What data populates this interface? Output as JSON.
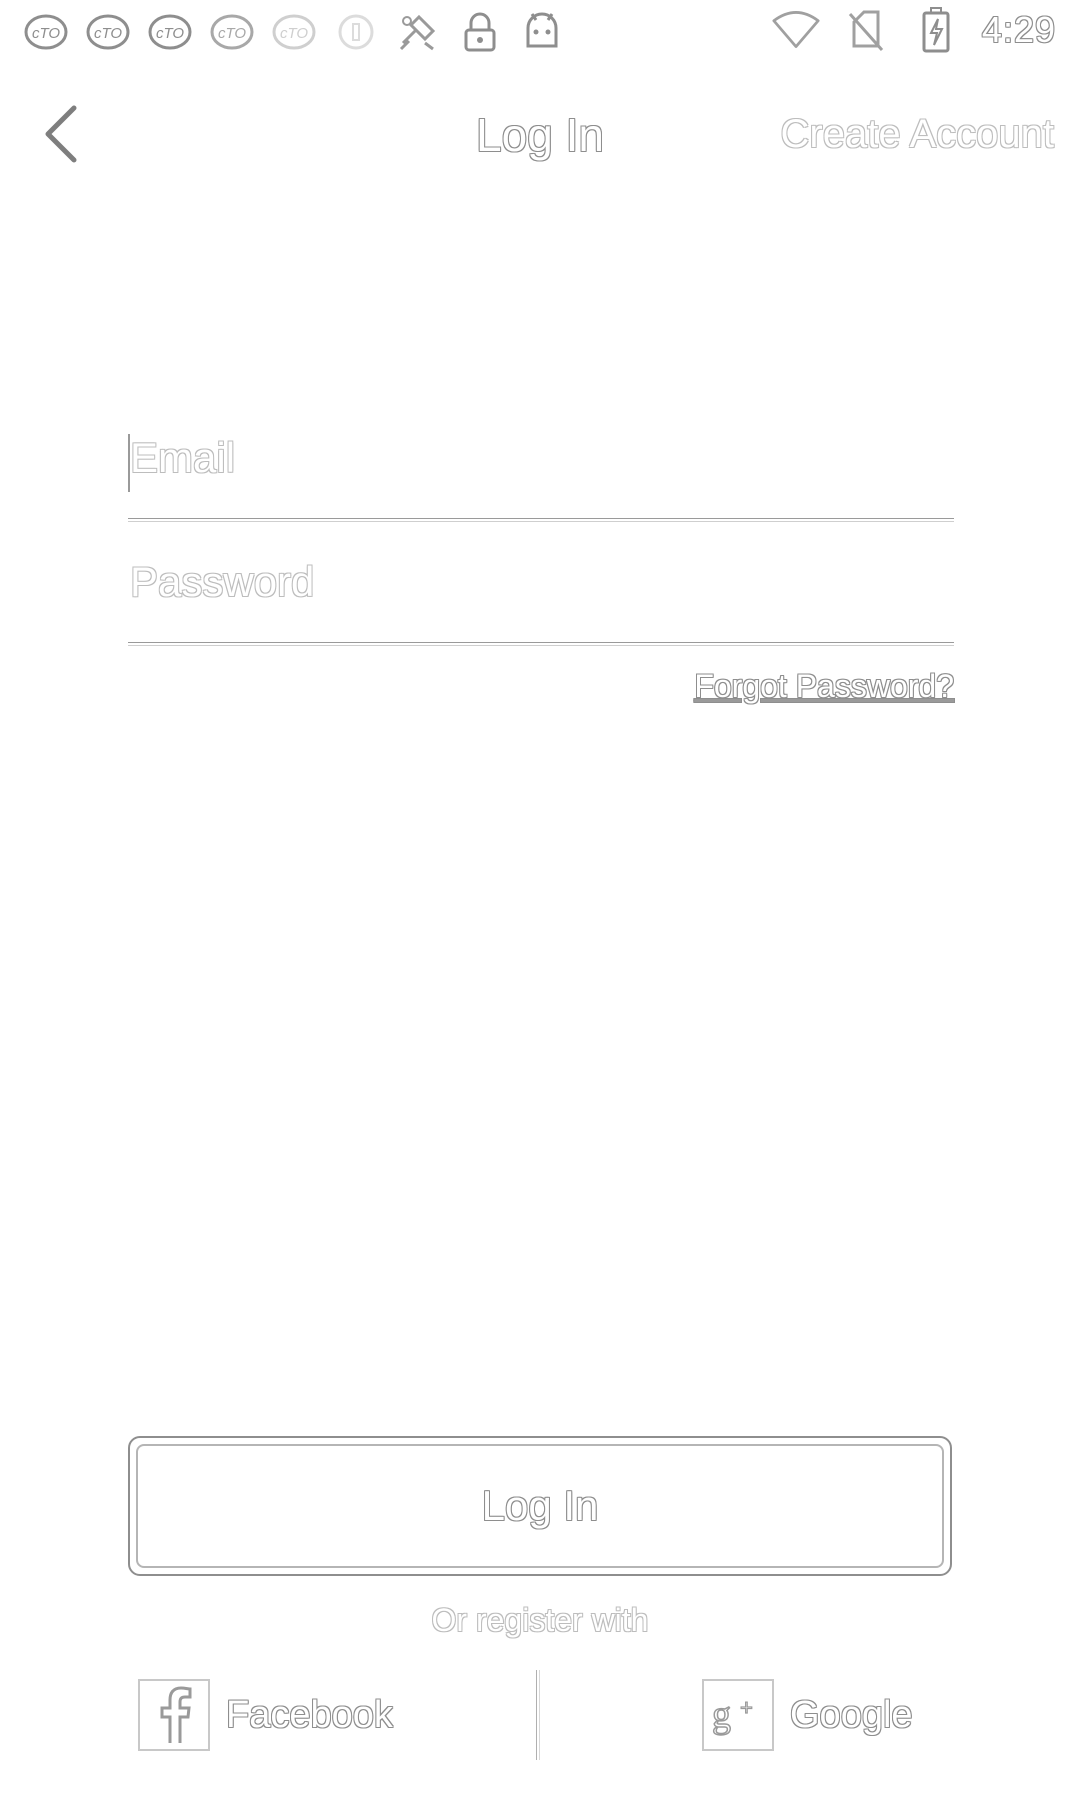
{
  "status_bar": {
    "left_icons": [
      "cutout-tv-icon",
      "cutout-tv-icon",
      "cutout-tv-icon",
      "cutout-tv-icon",
      "cutout-tv-icon",
      "circle-icon",
      "satellite-icon",
      "lock-icon",
      "android-icon"
    ],
    "right_icons": [
      "wifi-icon",
      "no-sim-icon",
      "battery-charging-icon"
    ],
    "time": "4:29"
  },
  "app_bar": {
    "back_icon": "chevron-left-icon",
    "title": "Log In",
    "create_account": "Create Account"
  },
  "form": {
    "email_placeholder": "Email",
    "password_placeholder": "Password",
    "forgot_password": "Forgot Password?"
  },
  "login_button": "Log In",
  "register": {
    "label": "Or register with",
    "facebook": "Facebook",
    "google": "Google"
  },
  "colors": {
    "background": "#ffffff",
    "outline": "#8e8e8e"
  }
}
